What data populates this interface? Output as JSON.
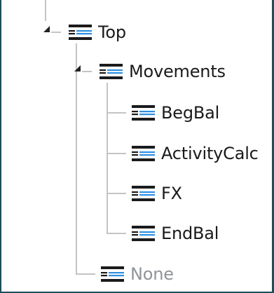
{
  "tree": {
    "root": {
      "label": "Top",
      "icon": "dimension-member-icon",
      "expanded": true
    },
    "group": {
      "label": "Movements",
      "icon": "dimension-member-icon",
      "expanded": true
    },
    "children": [
      {
        "label": "BegBal",
        "icon": "dimension-member-icon"
      },
      {
        "label": "ActivityCalc",
        "icon": "dimension-member-icon"
      },
      {
        "label": "FX",
        "icon": "dimension-member-icon"
      },
      {
        "label": "EndBal",
        "icon": "dimension-member-icon"
      }
    ],
    "sibling": {
      "label": "None",
      "icon": "dimension-member-icon",
      "muted": true
    }
  },
  "colors": {
    "frame": "#1f4e5a",
    "icon_dark": "#1b1b1b",
    "icon_accent": "#2f8fe0",
    "connector": "#c4c4c4",
    "muted_text": "#8f9499"
  }
}
